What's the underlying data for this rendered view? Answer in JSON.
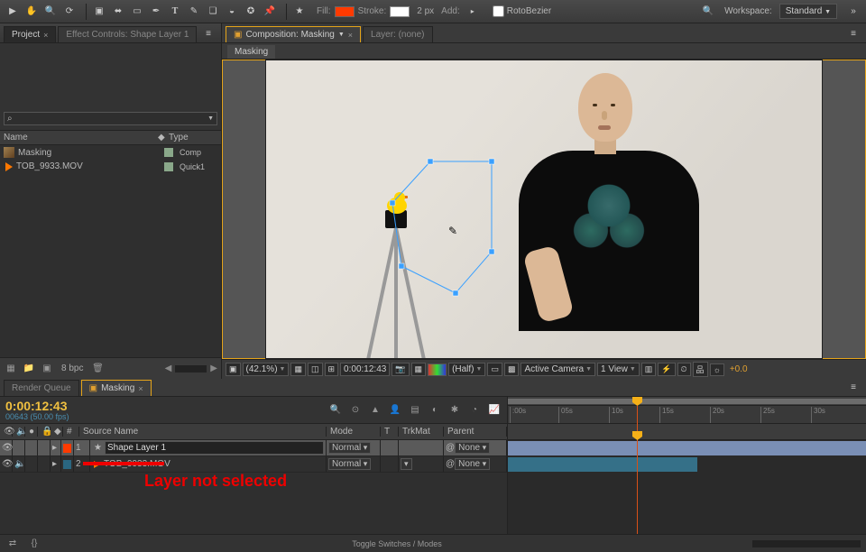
{
  "toolbar": {
    "fill_label": "Fill:",
    "stroke_label": "Stroke:",
    "stroke_px": "2 px",
    "add_label": "Add:",
    "rotobezier_label": "RotoBezier",
    "workspace_label": "Workspace:",
    "workspace_value": "Standard",
    "fill_color": "#ff3a00",
    "stroke_color": "#ffffff"
  },
  "project_panel": {
    "tabs": {
      "project": "Project",
      "effect_controls": "Effect Controls: Shape Layer 1"
    },
    "panel_menu": "≡",
    "search_placeholder": "",
    "search_icon": "⌕",
    "columns": {
      "name": "Name",
      "type": "Type"
    },
    "items": [
      {
        "name": "Masking",
        "type": "Comp"
      },
      {
        "name": "TOB_9933.MOV",
        "type": "Quick1"
      }
    ],
    "footer_bpc": "8 bpc"
  },
  "viewer": {
    "tabs": {
      "composition": "Composition: Masking",
      "layer": "Layer: (none)"
    },
    "subtab": "Masking",
    "footer": {
      "zoom": "(42.1%)",
      "timecode": "0:00:12:43",
      "resolution": "(Half)",
      "view": "Active Camera",
      "nviews": "1 View",
      "exposure": "+0.0"
    }
  },
  "timeline": {
    "tabs": {
      "render_queue": "Render Queue",
      "masking": "Masking"
    },
    "timecode": "0:00:12:43",
    "framecounter": "00643 (50.00 fps)",
    "columns": {
      "source_name": "Source Name",
      "mode": "Mode",
      "trkmat": "TrkMat",
      "parent": "Parent",
      "t": "T",
      "num": "#"
    },
    "layers": [
      {
        "index": "1",
        "color": "#ff3a00",
        "name": "Shape Layer 1",
        "mode": "Normal",
        "trkmat": "",
        "parent": "None",
        "selected": true
      },
      {
        "index": "2",
        "color": "#2a6680",
        "name": "TOB_9933.MOV",
        "mode": "Normal",
        "trkmat": "",
        "parent": "None",
        "selected": false
      }
    ],
    "ruler_marks": [
      ":00s",
      "05s",
      "10s",
      "15s",
      "20s",
      "25s",
      "30s"
    ],
    "toggle_switches": "Toggle Switches / Modes"
  },
  "annotation": {
    "text": "Layer not selected"
  }
}
